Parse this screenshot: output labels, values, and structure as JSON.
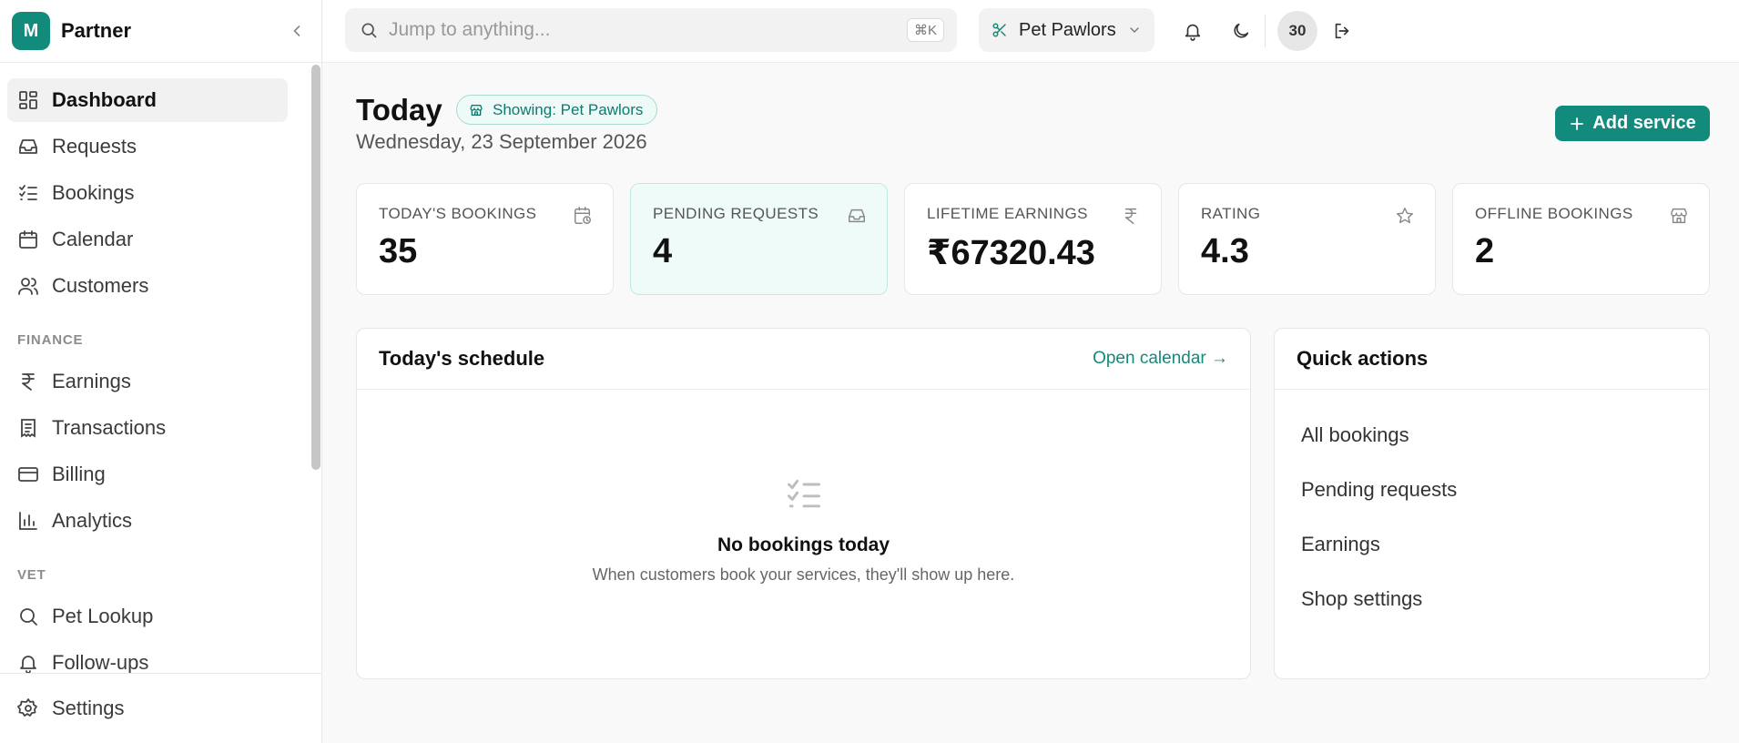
{
  "sidebar": {
    "brand_initial": "M",
    "brand_name": "Partner",
    "nav_main": [
      {
        "label": "Dashboard",
        "icon": "dashboard-icon"
      },
      {
        "label": "Requests",
        "icon": "inbox-icon"
      },
      {
        "label": "Bookings",
        "icon": "checklist-icon"
      },
      {
        "label": "Calendar",
        "icon": "calendar-icon"
      },
      {
        "label": "Customers",
        "icon": "users-icon"
      }
    ],
    "finance_section": "FINANCE",
    "nav_finance": [
      {
        "label": "Earnings",
        "icon": "rupee-icon"
      },
      {
        "label": "Transactions",
        "icon": "receipt-icon"
      },
      {
        "label": "Billing",
        "icon": "credit-card-icon"
      },
      {
        "label": "Analytics",
        "icon": "bar-chart-icon"
      }
    ],
    "vet_section": "VET",
    "nav_vet": [
      {
        "label": "Pet Lookup",
        "icon": "search-icon"
      },
      {
        "label": "Follow-ups",
        "icon": "bell-icon"
      }
    ],
    "settings_label": "Settings"
  },
  "topbar": {
    "search_placeholder": "Jump to anything...",
    "shortcut": "⌘K",
    "shop_name": "Pet Pawlors",
    "avatar_text": "30"
  },
  "header": {
    "title": "Today",
    "badge": "Showing: Pet Pawlors",
    "date": "Wednesday, 23 September 2026",
    "add_button": "Add service"
  },
  "stats": [
    {
      "label": "TODAY'S BOOKINGS",
      "value": "35",
      "icon": "calendar-clock-icon"
    },
    {
      "label": "PENDING REQUESTS",
      "value": "4",
      "icon": "inbox-icon"
    },
    {
      "label": "LIFETIME EARNINGS",
      "value": "₹67320.43",
      "icon": "rupee-icon"
    },
    {
      "label": "RATING",
      "value": "4.3",
      "icon": "star-icon"
    },
    {
      "label": "OFFLINE BOOKINGS",
      "value": "2",
      "icon": "store-icon"
    }
  ],
  "schedule": {
    "title": "Today's schedule",
    "link": "Open calendar →",
    "empty_title": "No bookings today",
    "empty_sub": "When customers book your services, they'll show up here."
  },
  "quick_actions": {
    "title": "Quick actions",
    "items": [
      "All bookings",
      "Pending requests",
      "Earnings",
      "Shop settings"
    ]
  },
  "colors": {
    "accent": "#128a7c",
    "highlight_bg": "#effbf9"
  }
}
